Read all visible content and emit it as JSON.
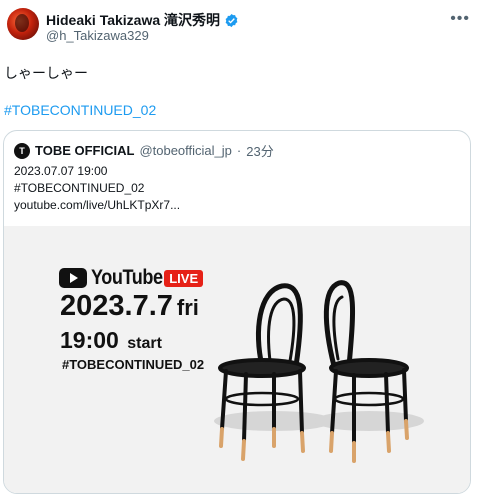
{
  "tweet": {
    "author_name": "Hideaki Takizawa 滝沢秀明",
    "handle": "@h_Takizawa329",
    "text": "しゃーしゃー",
    "hashtag": "#TOBECONTINUED_02",
    "more_icon": "more-horizontal-icon",
    "verified_icon": "verified-badge-icon"
  },
  "quote": {
    "avatar_letter": "T",
    "name": "TOBE OFFICIAL",
    "handle": "@tobeofficial_jp",
    "separator": "·",
    "time": "23分",
    "line1": "2023.07.07 19:00",
    "line2": "#TOBECONTINUED_02",
    "line3": "youtube.com/live/UhLKTpXr7..."
  },
  "media": {
    "youtube_label": "YouTube",
    "live_label": "LIVE",
    "date": "2023.7.7",
    "day": "fri",
    "time": "19:00",
    "start": "start",
    "hashtag": "#TOBECONTINUED_02"
  },
  "colors": {
    "accent": "#1d9bf0",
    "live_red": "#e62117",
    "text_secondary": "#536471"
  }
}
